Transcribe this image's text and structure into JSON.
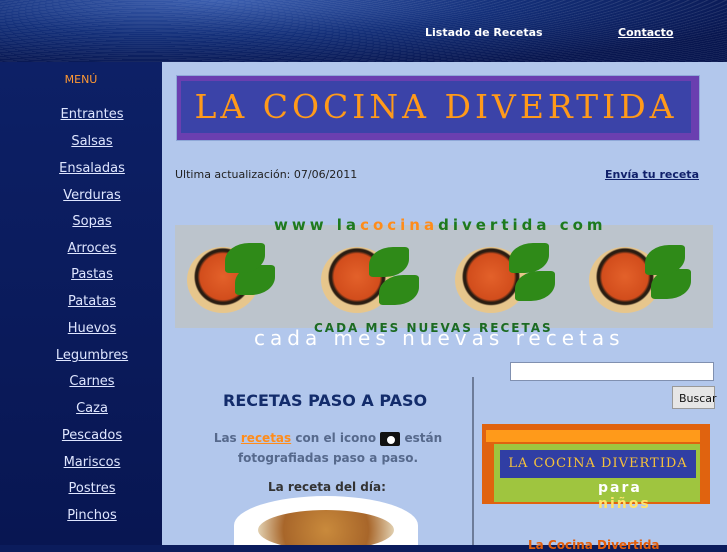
{
  "topnav": {
    "recetas": "Listado de Recetas",
    "contacto": "Contacto"
  },
  "sidebar": {
    "title": "MENÚ",
    "items": [
      "Entrantes",
      "Salsas",
      "Ensaladas",
      "Verduras",
      "Sopas",
      "Arroces",
      "Pastas",
      "Patatas",
      "Huevos",
      "Legumbres",
      "Carnes",
      "Caza",
      "Pescados",
      "Mariscos",
      "Postres",
      "Pinchos"
    ]
  },
  "main": {
    "banner": "LA COCINA DIVERTIDA",
    "update": "Ultima actualización: 07/06/2011",
    "envia": "Envía tu receta",
    "url_a": "www la",
    "url_b": "cocina",
    "url_c": "divertida com",
    "slogan_green": "CADA MES NUEVAS RECETAS",
    "slogan_white": "cada mes nuevas recetas",
    "section_title": "RECETAS PASO A PASO",
    "las": "Las",
    "recetas_link": "recetas",
    "con_el": "con el icono",
    "estan": "están fotografiadas paso a paso.",
    "dia": "La receta del día:"
  },
  "search": {
    "button": "Buscar",
    "value": ""
  },
  "ninos": {
    "banner": "LA COCINA DIVERTIDA",
    "para": "para",
    "ninos": "niños"
  },
  "footer_link": "La Cocina Divertida"
}
